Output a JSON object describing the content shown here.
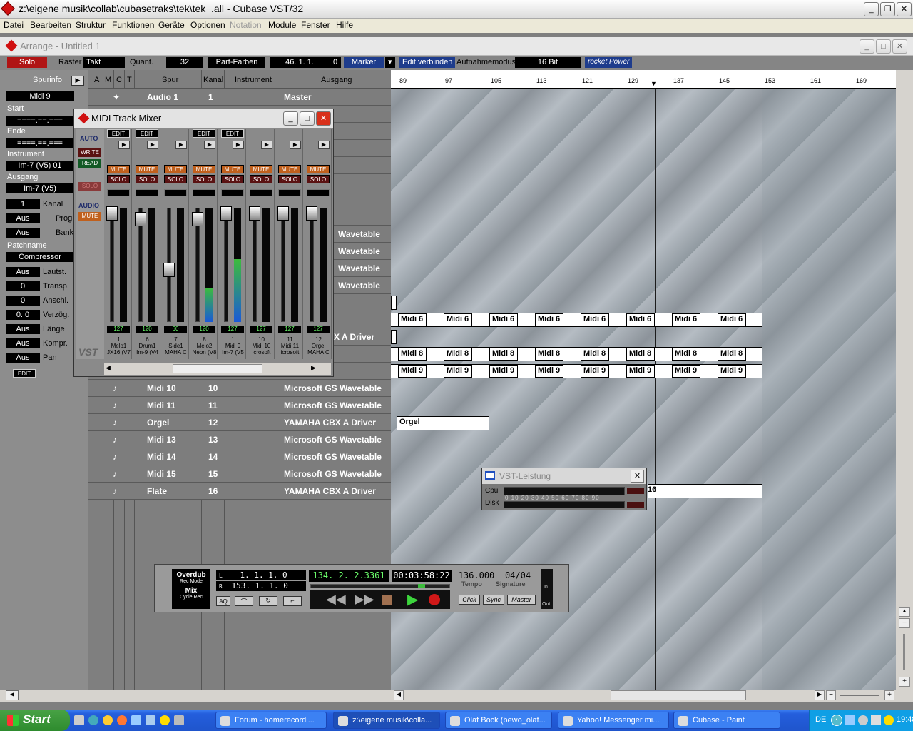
{
  "app": {
    "title": "z:\\eigene musik\\collab\\cubasetraks\\tek\\tek_.all - Cubase VST/32",
    "menu": [
      "Datei",
      "Bearbeiten",
      "Struktur",
      "Funktionen",
      "Geräte",
      "Optionen",
      "Notation",
      "Module",
      "Fenster",
      "Hilfe"
    ]
  },
  "arrange": {
    "title": "Arrange - Untitled 1",
    "toolbar": {
      "solo": "Solo",
      "raster_label": "Raster",
      "raster_value": "Takt",
      "quant_label": "Quant.",
      "quant_value": "32",
      "part_colors": "Part-Farben",
      "position": "46. 1. 1.",
      "position_tick": "0",
      "marker": "Marker",
      "edit_link": "Edit.verbinden",
      "rec_mode_label": "Aufnahmemodus",
      "rec_mode_value": "16 Bit",
      "rocket": "rocket Power"
    },
    "info": {
      "header": "Spurinfo",
      "track_name": "Midi 9",
      "start_label": "Start",
      "start_value": "====.==.===",
      "end_label": "Ende",
      "end_value": "====.==.===",
      "instrument_label": "Instrument",
      "instrument_value": "Im-7 (V5) 01",
      "output_label": "Ausgang",
      "output_value": "Im-7 (V5)",
      "kanal_val": "1",
      "kanal_lab": "Kanal",
      "prog_val": "Aus",
      "prog_lab": "Prog.",
      "bank_val": "Aus",
      "bank_lab": "Bank",
      "patchname_label": "Patchname",
      "patchname_value": "Compressor",
      "lautst_val": "Aus",
      "lautst_lab": "Lautst.",
      "transp_val": "0",
      "transp_lab": "Transp.",
      "anschl_val": "0",
      "anschl_lab": "Anschl.",
      "verzog_val": "0.  0",
      "verzog_lab": "Verzög.",
      "lange_val": "Aus",
      "lange_lab": "Länge",
      "kompr_val": "Aus",
      "kompr_lab": "Kompr.",
      "pan_val": "Aus",
      "pan_lab": "Pan",
      "edit": "EDIT"
    },
    "columns": {
      "a": "A",
      "m": "M",
      "c": "C",
      "t": "T",
      "spur": "Spur",
      "kanal": "Kanal",
      "instrument": "Instrument",
      "ausgang": "Ausgang"
    },
    "tracks_top": [
      {
        "name": "Audio 1",
        "ch": "1",
        "out": "Master",
        "sym": "✦"
      }
    ],
    "tracks_side_outputs": [
      "Wavetable",
      "Wavetable",
      "Wavetable",
      "Wavetable",
      "X A Driver"
    ],
    "tracks_bottom": [
      {
        "name": "Midi 10",
        "ch": "10",
        "out": "Microsoft GS Wavetable",
        "sym": "♪"
      },
      {
        "name": "Midi 11",
        "ch": "11",
        "out": "Microsoft GS Wavetable",
        "sym": "♪"
      },
      {
        "name": "Orgel",
        "ch": "12",
        "out": "YAMAHA CBX A Driver",
        "sym": "♪"
      },
      {
        "name": "Midi 13",
        "ch": "13",
        "out": "Microsoft GS Wavetable",
        "sym": "♪"
      },
      {
        "name": "Midi 14",
        "ch": "14",
        "out": "Microsoft GS Wavetable",
        "sym": "♪"
      },
      {
        "name": "Midi 15",
        "ch": "15",
        "out": "Microsoft GS Wavetable",
        "sym": "♪"
      },
      {
        "name": "Flate",
        "ch": "16",
        "out": "YAMAHA CBX A Driver",
        "sym": "♪"
      }
    ],
    "ruler": [
      "89",
      "97",
      "105",
      "113",
      "121",
      "129",
      "137",
      "145",
      "153",
      "161",
      "169"
    ],
    "parts": {
      "midi6": "Midi 6",
      "midi8": "Midi 8",
      "midi9": "Midi 9",
      "orgel": "Orgel",
      "flate_num": "16"
    }
  },
  "mixer": {
    "title": "MIDI Track Mixer",
    "auto": "AUTO",
    "write": "WRITE",
    "read": "READ",
    "audio": "AUDIO",
    "mute_global": "MUTE",
    "solo_global": "SOLO",
    "logo": "VST",
    "edit": "EDIT",
    "mute": "MUTE",
    "solo": "SOLO",
    "strips": [
      {
        "num": "1",
        "name": "Melo1",
        "dev": "JX16 (V7",
        "val": "127",
        "edit": true,
        "level": 0.0
      },
      {
        "num": "6",
        "name": "Drum1",
        "dev": "Im-9 (V4",
        "val": "120",
        "edit": true,
        "level": 0.0
      },
      {
        "num": "7",
        "name": "Side1",
        "dev": "MAHA C",
        "val": "60",
        "edit": false,
        "level": 0.0
      },
      {
        "num": "8",
        "name": "Melo2",
        "dev": "Neon (V8",
        "val": "120",
        "edit": true,
        "level": 0.3
      },
      {
        "num": "1",
        "name": "Midi 9",
        "dev": "Im-7 (V5",
        "val": "127",
        "edit": true,
        "level": 0.55
      },
      {
        "num": "10",
        "name": "Midi 10",
        "dev": "icrosoft",
        "val": "127",
        "edit": false,
        "level": 0.0
      },
      {
        "num": "11",
        "name": "Midi 11",
        "dev": "icrosoft",
        "val": "127",
        "edit": false,
        "level": 0.0
      },
      {
        "num": "12",
        "name": "Orgel",
        "dev": "MAHA C",
        "val": "127",
        "edit": false,
        "level": 0.0
      }
    ]
  },
  "vst": {
    "title": "VST-Leistung",
    "cpu": "Cpu",
    "disk": "Disk",
    "scale": "0 10 20 30 40 50 60 70 80 90"
  },
  "transport": {
    "overdub": "Overdub",
    "recmode": "Rec Mode",
    "mix": "Mix",
    "cyclerec": "Cycle Rec",
    "l_label": "L",
    "l_value": "1.  1.  1.    0",
    "r_label": "R",
    "r_value": "153.  1.  1.    0",
    "position": "134.  2.  2.3361",
    "time": "00:03:58:22",
    "tempo": "136.000",
    "signature": "04/04",
    "tempo_label": "Tempo",
    "signature_label": "Signature",
    "aq": "AQ",
    "click": "Click",
    "sync": "Sync",
    "master": "Master",
    "in": "In",
    "out": "Out"
  },
  "taskbar": {
    "start": "Start",
    "tasks": [
      {
        "label": "Forum - homerecordi...",
        "active": false
      },
      {
        "label": "z:\\eigene musik\\colla...",
        "active": true
      },
      {
        "label": "Olaf Bock (bewo_olaf...",
        "active": false
      },
      {
        "label": "Yahoo! Messenger mi...",
        "active": false
      },
      {
        "label": "Cubase - Paint",
        "active": false
      }
    ],
    "lang": "DE",
    "clock": "19:48"
  }
}
